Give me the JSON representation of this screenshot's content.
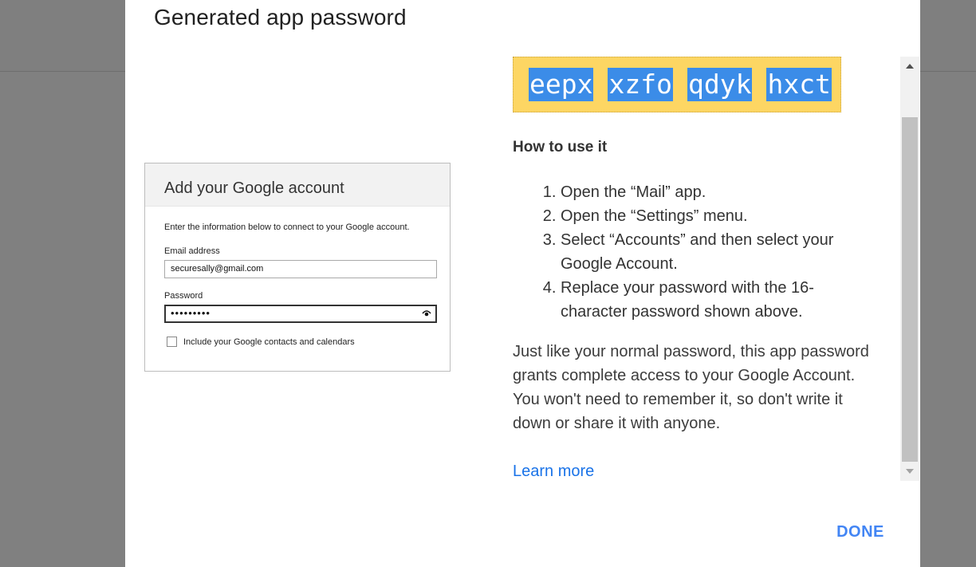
{
  "dialog": {
    "title": "Generated app password",
    "password_chunks": [
      "eepx",
      "xzfo",
      "qdyk",
      "hxct"
    ],
    "howto_heading": "How to use it",
    "steps": [
      "Open the “Mail” app.",
      "Open the “Settings” menu.",
      "Select “Accounts” and then select your Google Account.",
      "Replace your password with the 16-character password shown above."
    ],
    "info_text": "Just like your normal password, this app password grants complete access to your Google Account. You won't need to remember it, so don't write it down or share it with anyone.",
    "learn_more": "Learn more",
    "done_label": "DONE"
  },
  "illustration": {
    "title": "Add your Google account",
    "description": "Enter the information below to connect to your Google account.",
    "email_label": "Email address",
    "email_value": "securesally@gmail.com",
    "password_label": "Password",
    "password_value": "•••••••••",
    "checkbox_label": "Include your Google contacts and calendars"
  },
  "colors": {
    "accent": "#4285f4",
    "password_highlight": "#fdd663",
    "selection": "#3b8ce8"
  }
}
